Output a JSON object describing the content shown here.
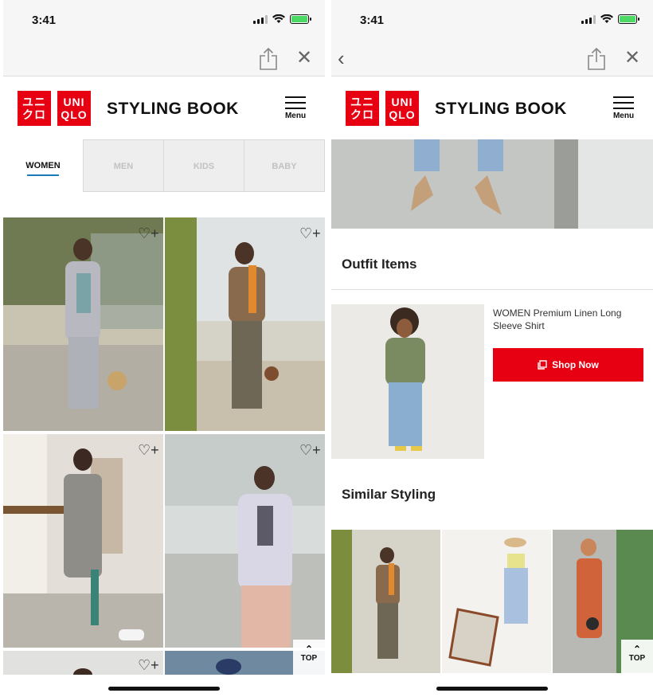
{
  "status_bar": {
    "time": "3:41"
  },
  "brand": {
    "logo_line1_left": "ユニ",
    "logo_line2_left": "クロ",
    "logo_line1_right": "UNI",
    "logo_line2_right": "QLO",
    "title": "STYLING BOOK",
    "menu_label": "Menu",
    "accent_color": "#e60012"
  },
  "tabs": [
    {
      "label": "WOMEN",
      "active": true
    },
    {
      "label": "MEN",
      "active": false
    },
    {
      "label": "KIDS",
      "active": false
    },
    {
      "label": "BABY",
      "active": false
    }
  ],
  "top_button_label": "TOP",
  "outfit_items": {
    "section_title": "Outfit Items",
    "product_name": "WOMEN Premium Linen Long Sleeve Shirt",
    "shop_button_label": "Shop Now"
  },
  "similar_styling": {
    "section_title": "Similar Styling"
  },
  "icons": [
    "share-icon",
    "close-icon",
    "back-icon",
    "heart-plus-icon",
    "menu-icon",
    "chevron-up-icon",
    "external-link-icon"
  ]
}
